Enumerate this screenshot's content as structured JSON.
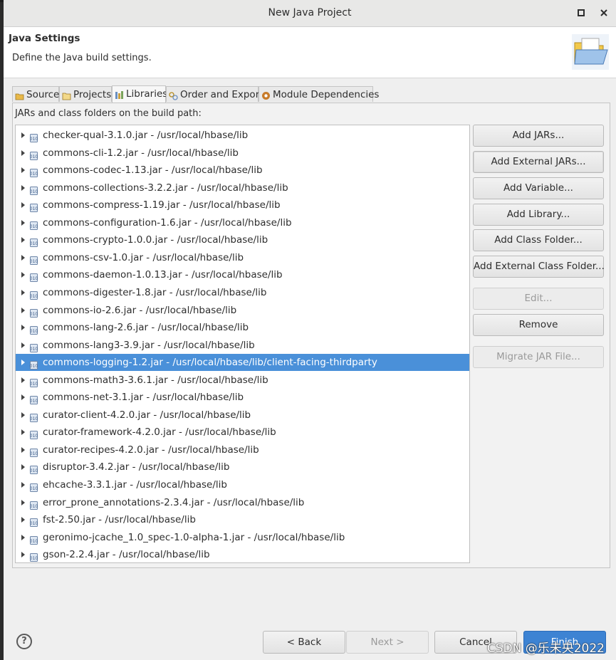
{
  "window": {
    "title": "New Java Project"
  },
  "header": {
    "title": "Java Settings",
    "description": "Define the Java build settings."
  },
  "tabs": [
    {
      "label": "Source",
      "icon": "source-folder-icon"
    },
    {
      "label": "Projects",
      "icon": "projects-icon"
    },
    {
      "label": "Libraries",
      "icon": "libraries-icon",
      "active": true
    },
    {
      "label": "Order and Export",
      "icon": "order-export-icon"
    },
    {
      "label": "Module Dependencies",
      "icon": "module-dependencies-icon"
    }
  ],
  "libraries": {
    "label": "JARs and class folders on the build path:",
    "selected_index": 13,
    "items": [
      "checker-qual-3.1.0.jar - /usr/local/hbase/lib",
      "commons-cli-1.2.jar - /usr/local/hbase/lib",
      "commons-codec-1.13.jar - /usr/local/hbase/lib",
      "commons-collections-3.2.2.jar - /usr/local/hbase/lib",
      "commons-compress-1.19.jar - /usr/local/hbase/lib",
      "commons-configuration-1.6.jar - /usr/local/hbase/lib",
      "commons-crypto-1.0.0.jar - /usr/local/hbase/lib",
      "commons-csv-1.0.jar - /usr/local/hbase/lib",
      "commons-daemon-1.0.13.jar - /usr/local/hbase/lib",
      "commons-digester-1.8.jar - /usr/local/hbase/lib",
      "commons-io-2.6.jar - /usr/local/hbase/lib",
      "commons-lang-2.6.jar - /usr/local/hbase/lib",
      "commons-lang3-3.9.jar - /usr/local/hbase/lib",
      "commons-logging-1.2.jar - /usr/local/hbase/lib/client-facing-thirdparty",
      "commons-math3-3.6.1.jar - /usr/local/hbase/lib",
      "commons-net-3.1.jar - /usr/local/hbase/lib",
      "curator-client-4.2.0.jar - /usr/local/hbase/lib",
      "curator-framework-4.2.0.jar - /usr/local/hbase/lib",
      "curator-recipes-4.2.0.jar - /usr/local/hbase/lib",
      "disruptor-3.4.2.jar - /usr/local/hbase/lib",
      "ehcache-3.3.1.jar - /usr/local/hbase/lib",
      "error_prone_annotations-2.3.4.jar - /usr/local/hbase/lib",
      "fst-2.50.jar - /usr/local/hbase/lib",
      "geronimo-jcache_1.0_spec-1.0-alpha-1.jar - /usr/local/hbase/lib",
      "gson-2.2.4.jar - /usr/local/hbase/lib"
    ]
  },
  "buttons": {
    "add_jars": "Add JARs...",
    "add_external_jars": "Add External JARs...",
    "add_variable": "Add Variable...",
    "add_library": "Add Library...",
    "add_class_folder": "Add Class Folder...",
    "add_external_class_folder": "Add External Class Folder...",
    "edit": "Edit...",
    "remove": "Remove",
    "migrate_jar": "Migrate JAR File..."
  },
  "footer": {
    "back": "< Back",
    "next": "Next >",
    "cancel": "Cancel",
    "finish": "Finish",
    "help": "?"
  },
  "watermark": "CSDN @乐未央2022",
  "colors": {
    "selection": "#4a90d9",
    "primary": "#3d83d3"
  }
}
